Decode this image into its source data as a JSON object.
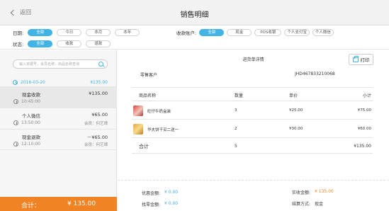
{
  "header": {
    "back_label": "返回",
    "title": "销售明细"
  },
  "filters": {
    "date_label": "日期:",
    "date_options": [
      {
        "label": "全部",
        "active": true
      },
      {
        "label": "今日",
        "active": false
      },
      {
        "label": "本月",
        "active": false
      },
      {
        "label": "本年",
        "active": false
      }
    ],
    "status_label": "状态:",
    "status_options": [
      {
        "label": "全部",
        "active": true
      },
      {
        "label": "收款",
        "active": false
      },
      {
        "label": "退款",
        "active": false
      }
    ],
    "account_label": "收款账户:",
    "account_options": [
      {
        "label": "全部",
        "active": true
      },
      {
        "label": "现金",
        "active": false
      },
      {
        "label": "POS收银",
        "active": false
      },
      {
        "label": "个人支付宝",
        "active": false
      },
      {
        "label": "个人微信",
        "active": false
      }
    ]
  },
  "sidebar": {
    "search_placeholder": "输入单据号，会员名称，商品名称查询",
    "date": "2016-03-20",
    "date_total": "¥135.00",
    "items": [
      {
        "type": "现金收款",
        "amount": "¥135.00",
        "time": "10:45:00",
        "operator": ""
      },
      {
        "type": "个人微信",
        "amount": "¥65.00",
        "time": "13:50:00",
        "operator": "会员：何艺璋"
      },
      {
        "type": "现金退款",
        "amount": "－¥65.00",
        "time": "12:10:00",
        "operator": "会员：何艺璋"
      }
    ],
    "total_label": "合计：",
    "total_value": "¥ 135.00"
  },
  "detail": {
    "title": "进货单详情",
    "print_label": "打印",
    "customer": "零售客户",
    "order_no": "JHD467833210068",
    "columns": [
      "商品名称",
      "数量",
      "单价",
      "小计"
    ],
    "rows": [
      {
        "name": "旺仔牛奶盒装",
        "qty": "3",
        "price": "¥25.00",
        "subtotal": "¥75.00"
      },
      {
        "name": "华夫饼干买二送一",
        "qty": "2",
        "price": "¥30.00",
        "subtotal": "¥60.00"
      }
    ],
    "footer": {
      "label": "合计",
      "qty": "5",
      "subtotal": "¥135.00"
    },
    "summary": {
      "discount_label": "优惠金额:",
      "discount_value": "¥ 0.00",
      "change_label": "找零金额:",
      "change_value": "¥ 0.00",
      "received_label": "实收金额:",
      "received_value": "¥ 135.00",
      "method_label": "结算方式:",
      "method_value": "现金"
    }
  },
  "colors": {
    "accent": "#42b3e5",
    "orange": "#f08323"
  }
}
